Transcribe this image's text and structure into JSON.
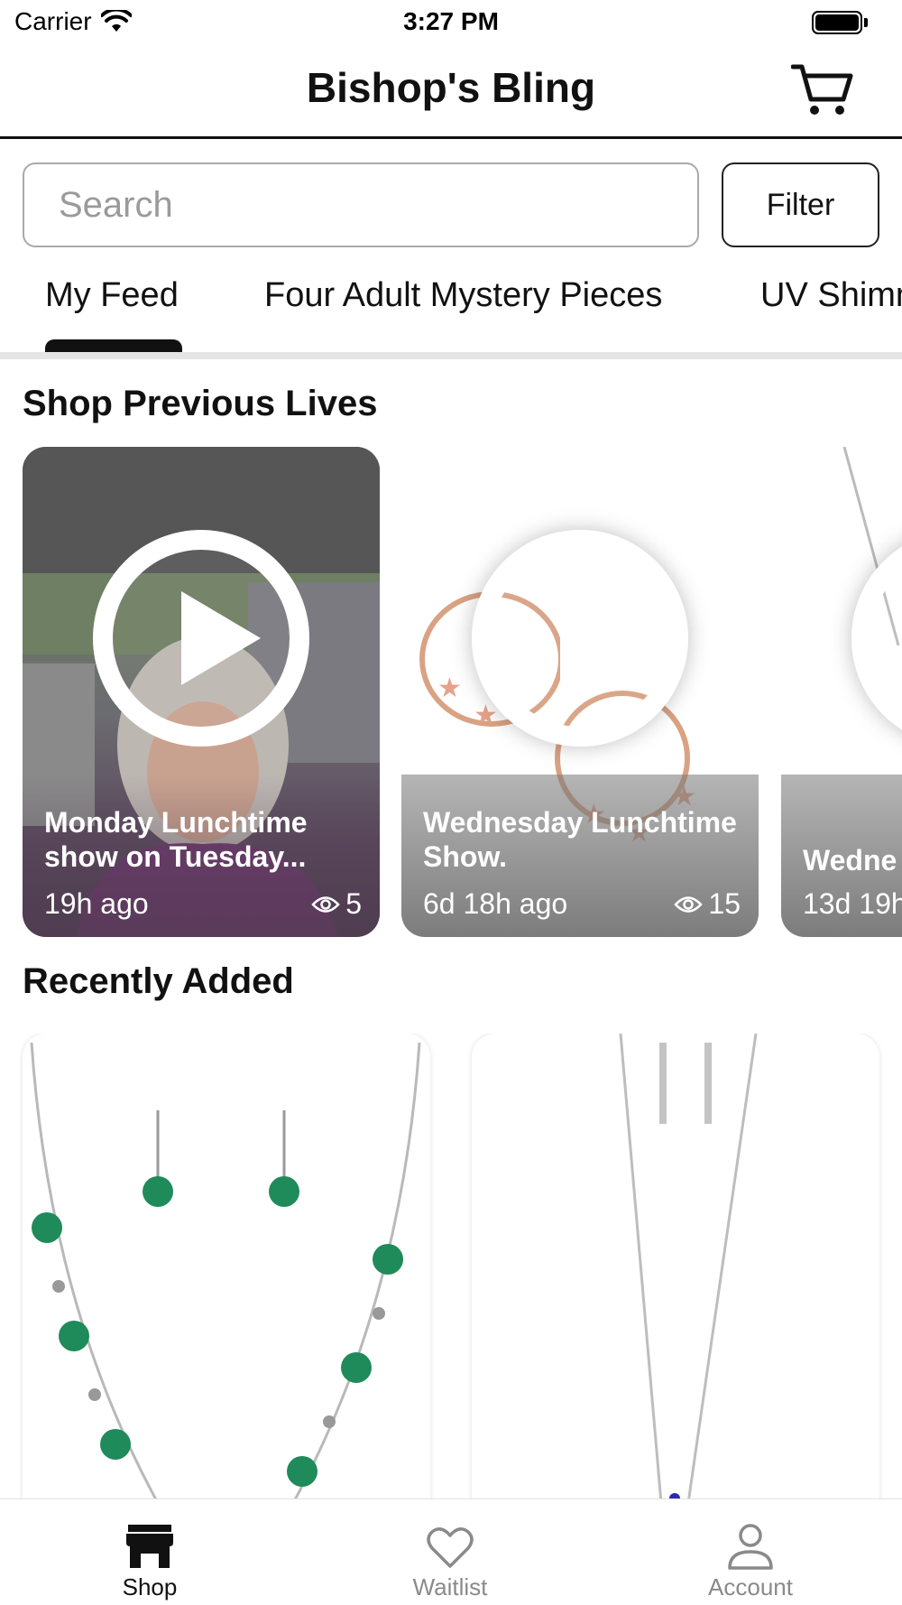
{
  "status_bar": {
    "carrier": "Carrier",
    "time": "3:27 PM"
  },
  "header": {
    "title": "Bishop's Bling",
    "cart_icon": "cart-icon"
  },
  "search": {
    "placeholder": "Search",
    "value": ""
  },
  "filter": {
    "label": "Filter"
  },
  "tabs": [
    {
      "label": "My Feed",
      "active": true
    },
    {
      "label": "Four Adult Mystery Pieces",
      "active": false
    },
    {
      "label": "UV Shimm",
      "active": false
    }
  ],
  "shop_previous_lives": {
    "title": "Shop Previous Lives",
    "items": [
      {
        "title": "Monday Lunchtime show on Tuesday...",
        "time": "19h ago",
        "views": "5"
      },
      {
        "title": "Wednesday Lunchtime Show.",
        "time": "6d 18h ago",
        "views": "15"
      },
      {
        "title": "Wedne",
        "time": "13d 19h",
        "views": ""
      }
    ]
  },
  "recently_added": {
    "title": "Recently Added",
    "items": [
      {
        "name": "green-bead-necklace"
      },
      {
        "name": "silver-chain-necklace"
      }
    ]
  },
  "bottom_nav": [
    {
      "label": "Shop",
      "icon": "store-icon",
      "active": true
    },
    {
      "label": "Waitlist",
      "icon": "heart-icon",
      "active": false
    },
    {
      "label": "Account",
      "icon": "person-icon",
      "active": false
    }
  ],
  "colors": {
    "accent": "#111111",
    "inactive": "#8a8a8a",
    "divider": "#e5e5e5",
    "bead_green": "#1f8a5a",
    "rose_gold": "#d9a283"
  }
}
